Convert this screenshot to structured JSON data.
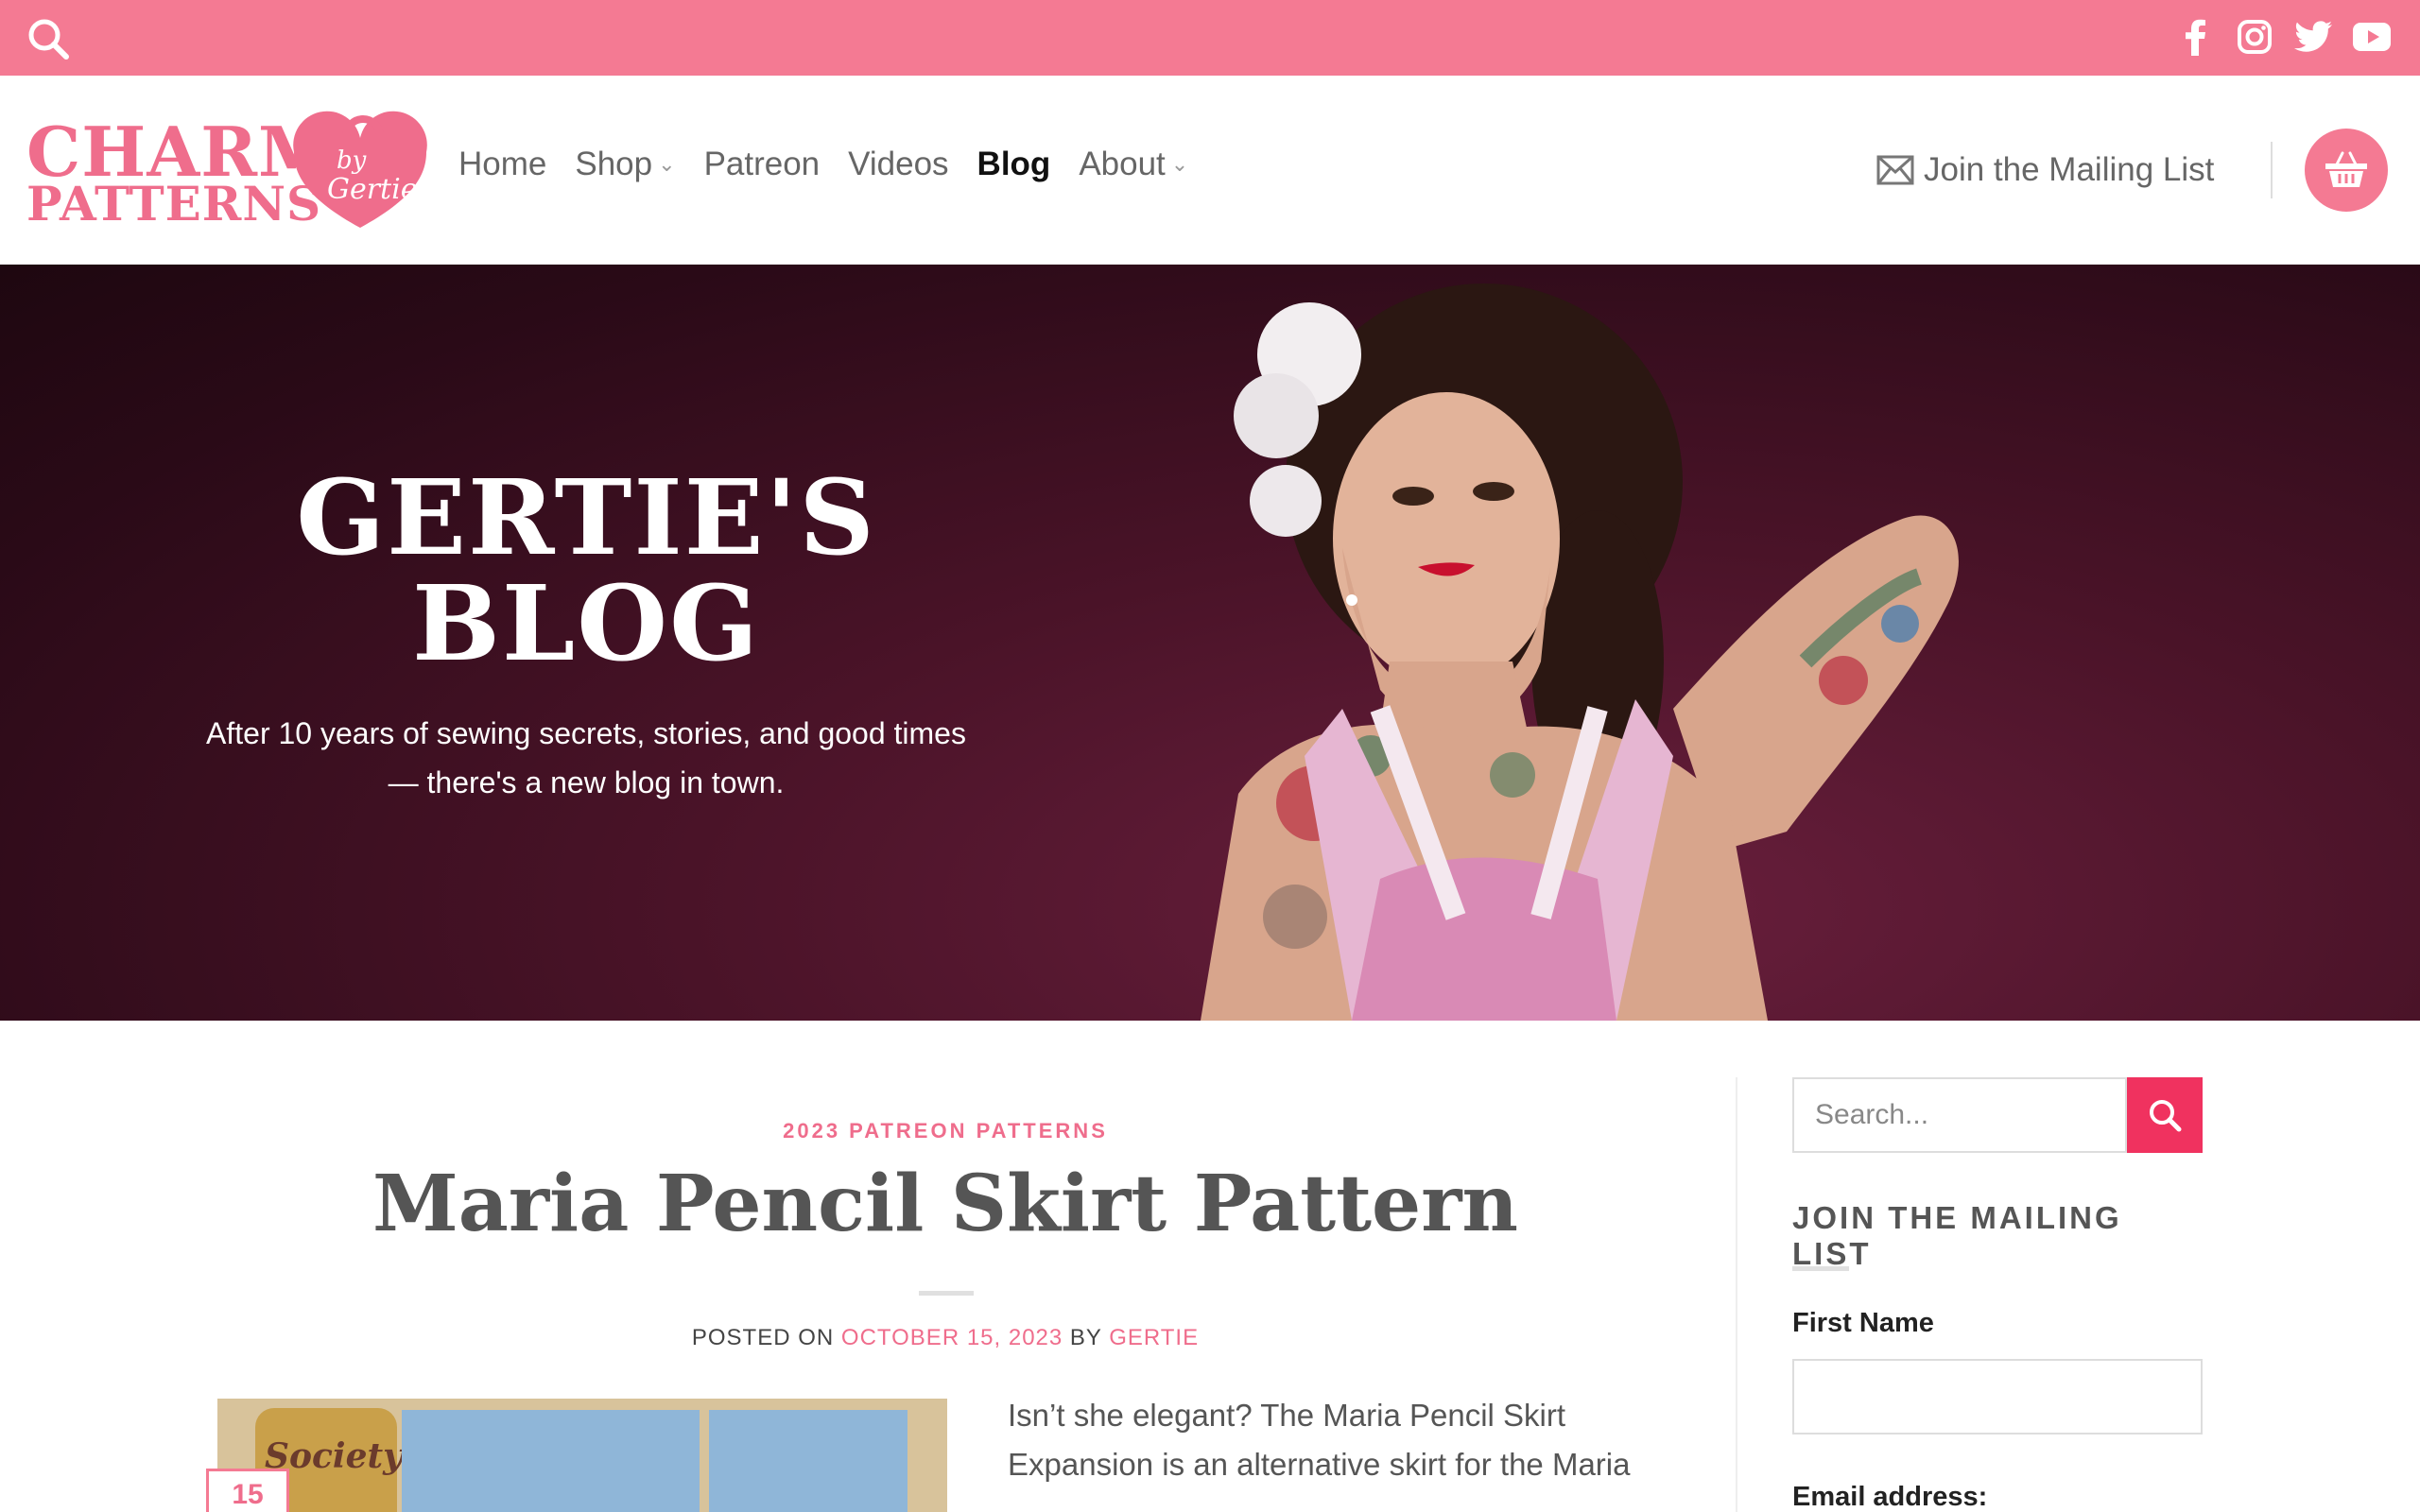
{
  "topbar": {
    "background_color": "#f47a93",
    "search_icon": "search-icon",
    "socials": [
      "facebook-icon",
      "instagram-icon",
      "twitter-icon",
      "youtube-icon"
    ]
  },
  "header": {
    "logo": {
      "line1": "CHARM",
      "line2": "PATTERNS",
      "badge_line1": "by",
      "badge_line2": "Gertie"
    },
    "nav": [
      {
        "label": "Home",
        "has_dropdown": false,
        "active": false
      },
      {
        "label": "Shop",
        "has_dropdown": true,
        "active": false
      },
      {
        "label": "Patreon",
        "has_dropdown": false,
        "active": false
      },
      {
        "label": "Videos",
        "has_dropdown": false,
        "active": false
      },
      {
        "label": "Blog",
        "has_dropdown": false,
        "active": true
      },
      {
        "label": "About",
        "has_dropdown": true,
        "active": false
      }
    ],
    "mailing_label": "Join the Mailing List",
    "cart_icon": "basket-icon"
  },
  "hero": {
    "title_line1": "GERTIE'S",
    "title_line2": "BLOG",
    "subtitle_line1": "After 10 years of sewing secrets, stories, and good times",
    "subtitle_line2": "— there's a new blog in town."
  },
  "post": {
    "category": "2023 PATREON PATTERNS",
    "title": "Maria Pencil Skirt Pattern",
    "meta_posted_on": "POSTED ON",
    "meta_date": "OCTOBER 15, 2023",
    "meta_by": "BY",
    "meta_author": "GERTIE",
    "date_badge_day": "15",
    "image_crest_text": "Society",
    "excerpt_line1": "Isn’t she elegant? The Maria Pencil Skirt",
    "excerpt_line2": "Expansion is an alternative skirt for the Maria"
  },
  "sidebar": {
    "search_placeholder": "Search...",
    "mailing_heading": "JOIN THE MAILING LIST",
    "first_name_label": "First Name",
    "email_label": "Email address:"
  },
  "colors": {
    "accent": "#f47a93",
    "accent_text": "#ef6d8c",
    "search_button": "#f0325f"
  }
}
